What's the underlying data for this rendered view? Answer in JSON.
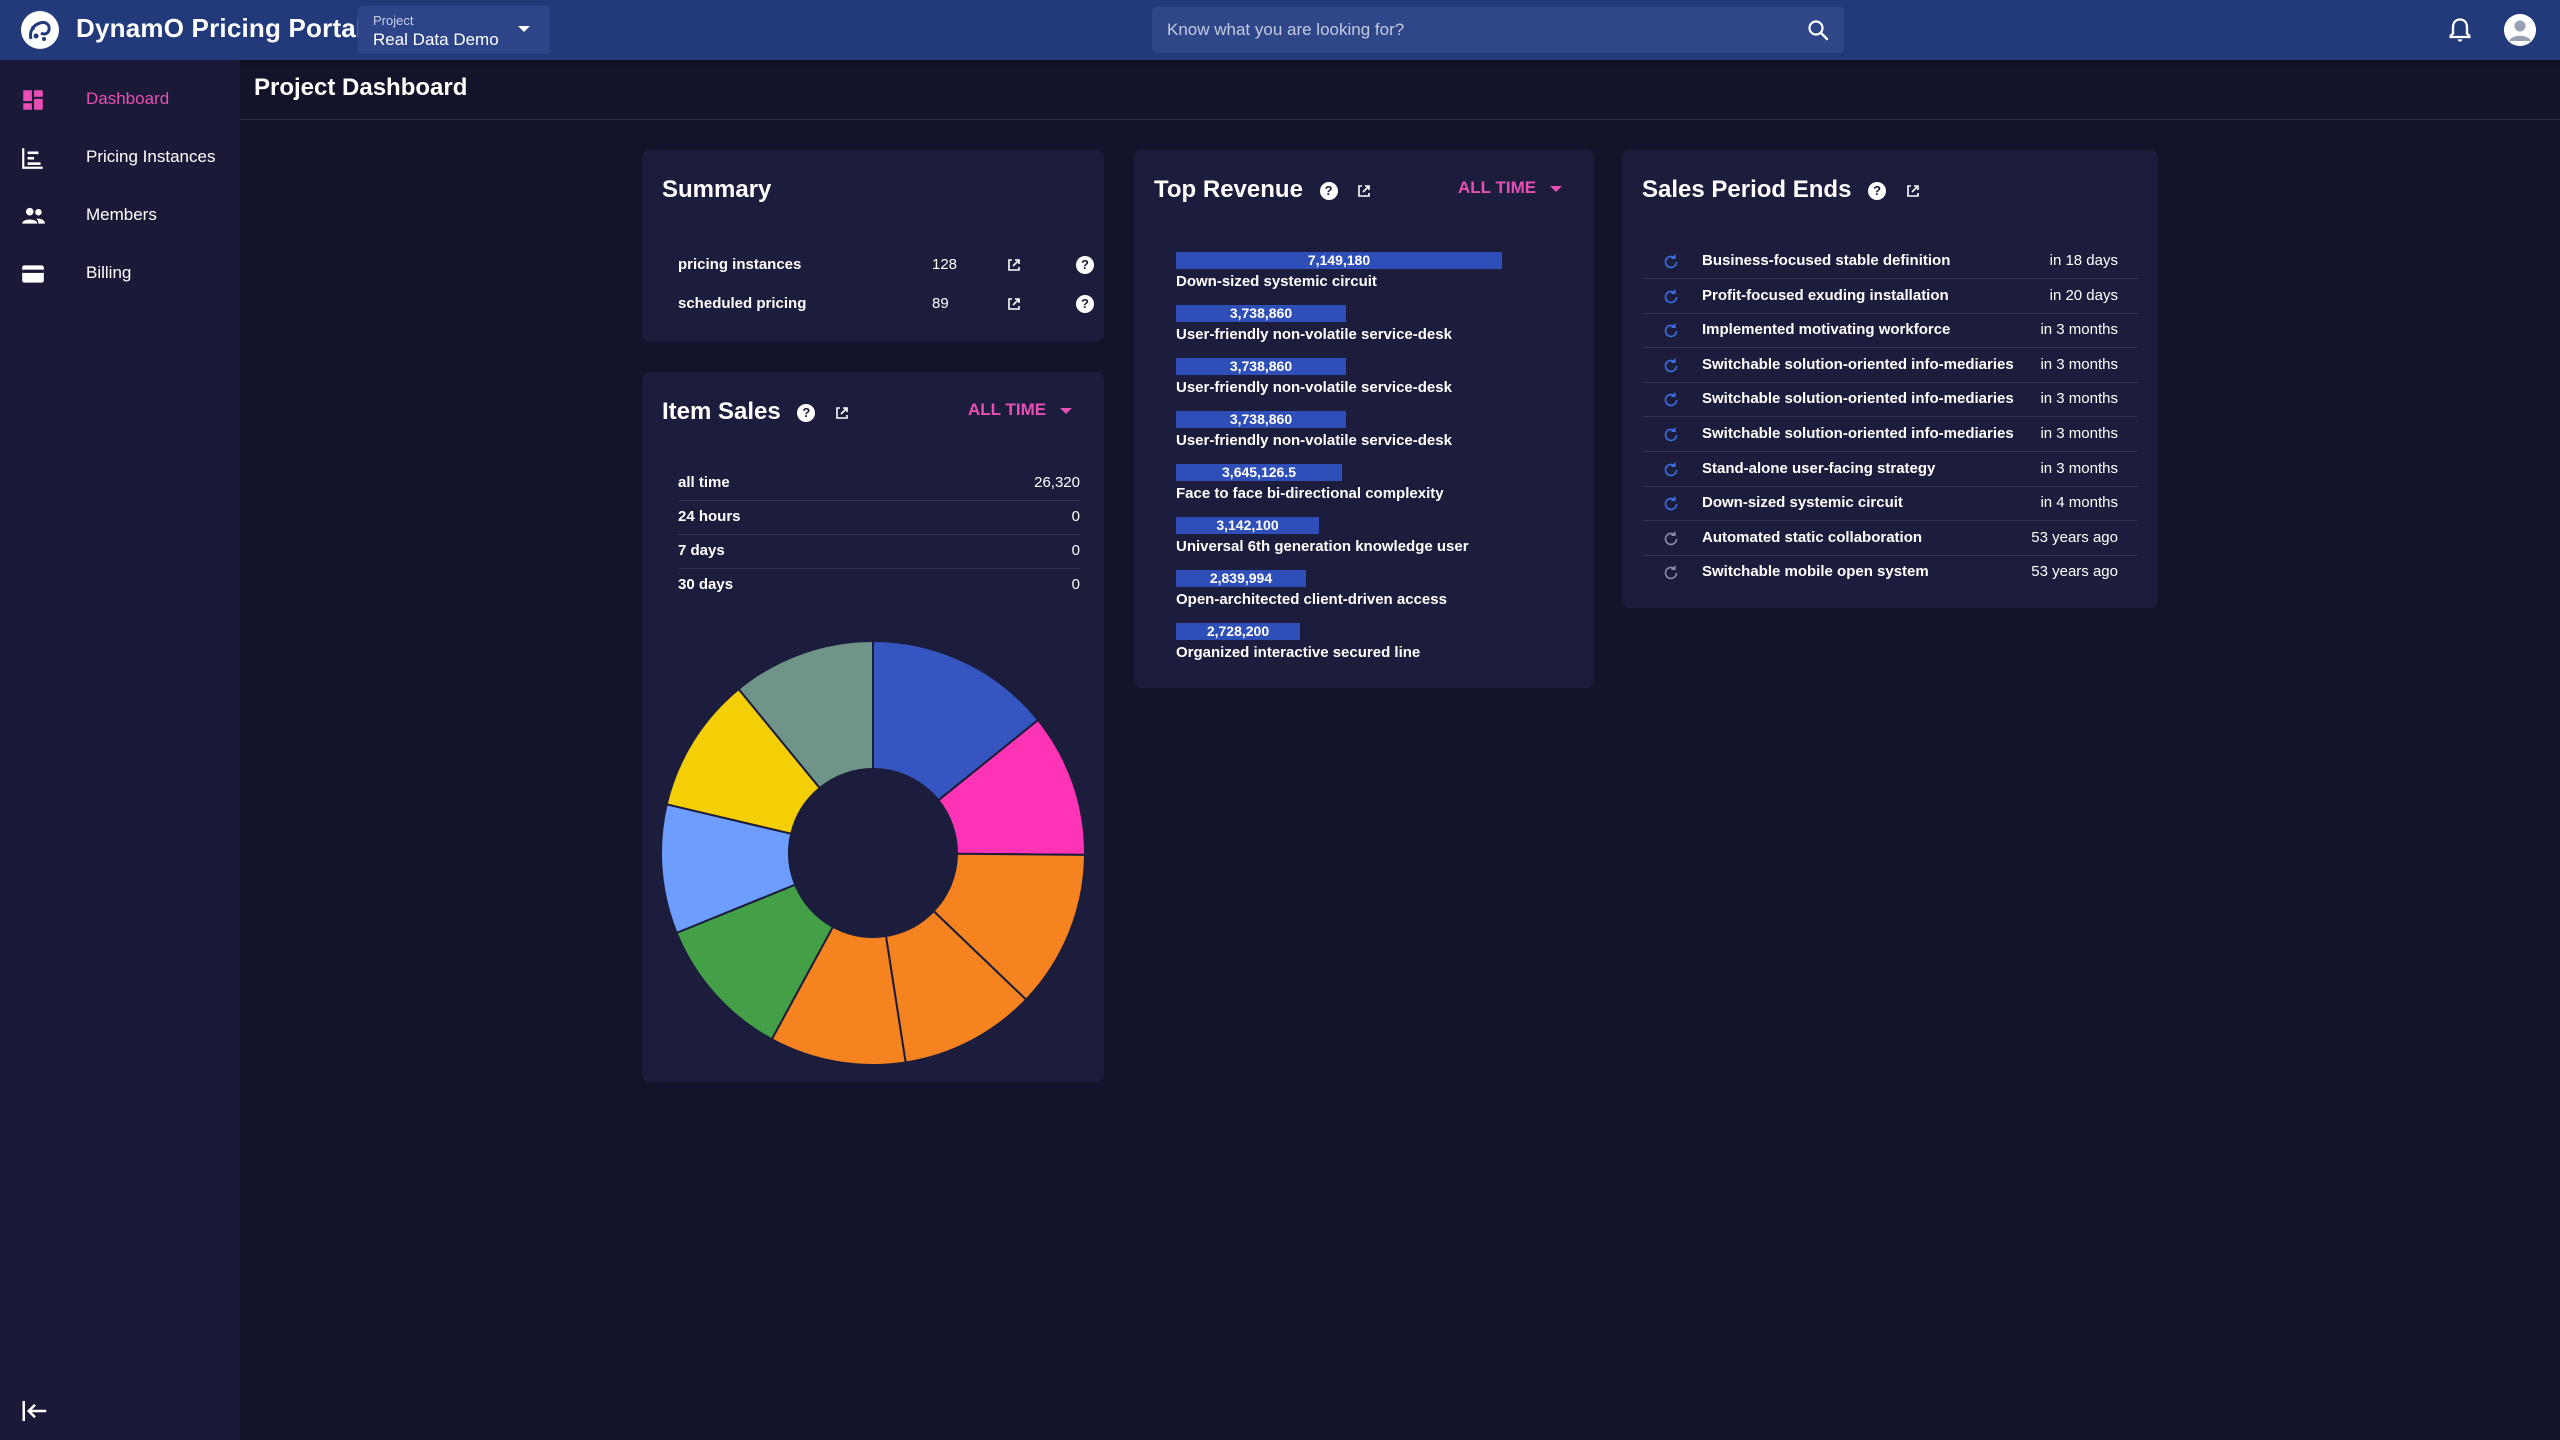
{
  "app": {
    "title": "DynamO Pricing Portal"
  },
  "project": {
    "label": "Project",
    "value": "Real Data Demo"
  },
  "search": {
    "placeholder": "Know what you are looking for?"
  },
  "sidebar": {
    "items": [
      {
        "label": "Dashboard",
        "icon": "dashboard-icon",
        "active": true
      },
      {
        "label": "Pricing Instances",
        "icon": "bar-chart-icon"
      },
      {
        "label": "Members",
        "icon": "people-icon"
      },
      {
        "label": "Billing",
        "icon": "credit-card-icon"
      }
    ]
  },
  "page": {
    "title": "Project Dashboard"
  },
  "summary": {
    "title": "Summary",
    "rows": [
      {
        "label": "pricing instances",
        "value": "128"
      },
      {
        "label": "scheduled pricing",
        "value": "89"
      }
    ]
  },
  "item_sales": {
    "title": "Item Sales",
    "period": "ALL TIME",
    "rows": [
      {
        "label": "all time",
        "value": "26,320"
      },
      {
        "label": "24 hours",
        "value": "0"
      },
      {
        "label": "7 days",
        "value": "0"
      },
      {
        "label": "30 days",
        "value": "0"
      }
    ]
  },
  "top_revenue": {
    "title": "Top Revenue",
    "period": "ALL TIME"
  },
  "sales_period": {
    "title": "Sales Period Ends",
    "rows": [
      {
        "name": "Business-focused stable definition",
        "time": "in 18 days",
        "status": "upcoming"
      },
      {
        "name": "Profit-focused exuding installation",
        "time": "in 20 days",
        "status": "upcoming"
      },
      {
        "name": "Implemented motivating workforce",
        "time": "in 3 months",
        "status": "upcoming"
      },
      {
        "name": "Switchable solution-oriented info-mediaries",
        "time": "in 3 months",
        "status": "upcoming"
      },
      {
        "name": "Switchable solution-oriented info-mediaries",
        "time": "in 3 months",
        "status": "upcoming"
      },
      {
        "name": "Switchable solution-oriented info-mediaries",
        "time": "in 3 months",
        "status": "upcoming"
      },
      {
        "name": "Stand-alone user-facing strategy",
        "time": "in 3 months",
        "status": "upcoming"
      },
      {
        "name": "Down-sized systemic circuit",
        "time": "in 4 months",
        "status": "upcoming"
      },
      {
        "name": "Automated static collaboration",
        "time": "53 years ago",
        "status": "past"
      },
      {
        "name": "Switchable mobile open system",
        "time": "53 years ago",
        "status": "past"
      }
    ]
  },
  "colors": {
    "accent": "#e84fb4",
    "topbar": "#233a7a",
    "bar": "#2f4fb8",
    "upcoming_icon": "#3d6fe0",
    "past_icon": "#8a8ca6"
  },
  "chart_data": [
    {
      "type": "bar",
      "orientation": "horizontal",
      "categories": [
        "Down-sized systemic circuit",
        "User-friendly non-volatile service-desk",
        "User-friendly non-volatile service-desk",
        "User-friendly non-volatile service-desk",
        "Face to face bi-directional complexity",
        "Universal 6th generation knowledge user",
        "Open-architected client-driven access",
        "Organized interactive secured line"
      ],
      "values": [
        7149180,
        3738860,
        3738860,
        3738860,
        3645126.5,
        3142100,
        2839994,
        2728200
      ],
      "labels": [
        "7,149,180",
        "3,738,860",
        "3,738,860",
        "3,738,860",
        "3,645,126.5",
        "3,142,100",
        "2,839,994",
        "2,728,200"
      ]
    },
    {
      "type": "pie",
      "donut": true,
      "values": [
        13,
        10,
        11,
        9.5,
        9.5,
        10,
        9,
        9.5,
        10
      ],
      "colors": [
        "#3556c0",
        "#ff33b5",
        "#f5831f",
        "#f5831f",
        "#f5831f",
        "#43a047",
        "#6d9eff",
        "#f5cf05",
        "#6e9588"
      ]
    }
  ]
}
